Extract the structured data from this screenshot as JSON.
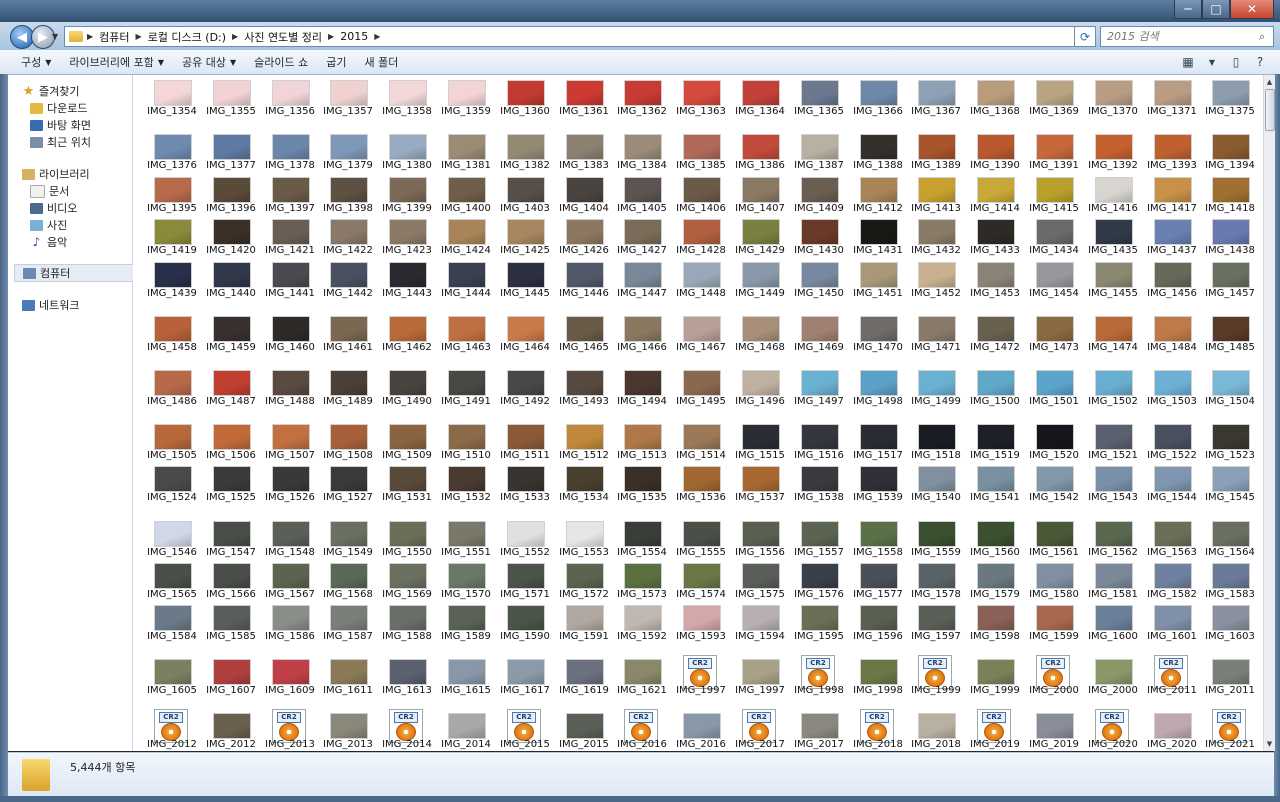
{
  "window": {
    "controls": [
      "minimize-icon",
      "maximize-icon",
      "close-icon"
    ],
    "control_glyphs": [
      "─",
      "□",
      "✕"
    ]
  },
  "address": {
    "crumbs": [
      "컴퓨터",
      "로컬 디스크 (D:)",
      "사진 연도별 정리",
      "2015"
    ],
    "search_placeholder": "2015 검색"
  },
  "toolbar": {
    "items": [
      {
        "label": "구성",
        "dropdown": true
      },
      {
        "label": "라이브러리에 포함",
        "dropdown": true
      },
      {
        "label": "공유 대상",
        "dropdown": true
      },
      {
        "label": "슬라이드 쇼",
        "dropdown": false
      },
      {
        "label": "굽기",
        "dropdown": false
      },
      {
        "label": "새 폴더",
        "dropdown": false
      }
    ]
  },
  "nav": {
    "items": [
      {
        "label": "즐겨찾기",
        "icon": "star-icon",
        "level": 0
      },
      {
        "label": "다운로드",
        "icon": "download-folder-icon",
        "level": 1
      },
      {
        "label": "바탕 화면",
        "icon": "desktop-icon",
        "level": 1
      },
      {
        "label": "최근 위치",
        "icon": "recent-places-icon",
        "level": 1
      },
      {
        "label": "라이브러리",
        "icon": "library-icon",
        "level": 0
      },
      {
        "label": "문서",
        "icon": "document-icon",
        "level": 1
      },
      {
        "label": "비디오",
        "icon": "video-icon",
        "level": 1
      },
      {
        "label": "사진",
        "icon": "picture-icon",
        "level": 1
      },
      {
        "label": "음악",
        "icon": "music-icon",
        "level": 1
      },
      {
        "label": "컴퓨터",
        "icon": "computer-icon",
        "level": 0,
        "selected": true
      },
      {
        "label": "네트워크",
        "icon": "network-icon",
        "level": 0
      }
    ]
  },
  "files": [
    [
      "IMG_1354",
      "IMG_1355",
      "IMG_1356",
      "IMG_1357",
      "IMG_1358",
      "IMG_1359",
      "IMG_1360",
      "IMG_1361",
      "IMG_1362",
      "IMG_1363",
      "IMG_1364",
      "IMG_1365",
      "IMG_1366",
      "IMG_1367",
      "IMG_1368",
      "IMG_1369",
      "IMG_1370",
      "IMG_1371",
      "IMG_1375"
    ],
    [
      "IMG_1376",
      "IMG_1377",
      "IMG_1378",
      "IMG_1379",
      "IMG_1380",
      "IMG_1381",
      "IMG_1382",
      "IMG_1383",
      "IMG_1384",
      "IMG_1385",
      "IMG_1386",
      "IMG_1387",
      "IMG_1388",
      "IMG_1389",
      "IMG_1390",
      "IMG_1391",
      "IMG_1392",
      "IMG_1393",
      "IMG_1394"
    ],
    [
      "IMG_1395",
      "IMG_1396",
      "IMG_1397",
      "IMG_1398",
      "IMG_1399",
      "IMG_1400",
      "IMG_1403",
      "IMG_1404",
      "IMG_1405",
      "IMG_1406",
      "IMG_1407",
      "IMG_1409",
      "IMG_1412",
      "IMG_1413",
      "IMG_1414",
      "IMG_1415",
      "IMG_1416",
      "IMG_1417",
      "IMG_1418"
    ],
    [
      "IMG_1419",
      "IMG_1420",
      "IMG_1421",
      "IMG_1422",
      "IMG_1423",
      "IMG_1424",
      "IMG_1425",
      "IMG_1426",
      "IMG_1427",
      "IMG_1428",
      "IMG_1429",
      "IMG_1430",
      "IMG_1431",
      "IMG_1432",
      "IMG_1433",
      "IMG_1434",
      "IMG_1435",
      "IMG_1437",
      "IMG_1438"
    ],
    [
      "IMG_1439",
      "IMG_1440",
      "IMG_1441",
      "IMG_1442",
      "IMG_1443",
      "IMG_1444",
      "IMG_1445",
      "IMG_1446",
      "IMG_1447",
      "IMG_1448",
      "IMG_1449",
      "IMG_1450",
      "IMG_1451",
      "IMG_1452",
      "IMG_1453",
      "IMG_1454",
      "IMG_1455",
      "IMG_1456",
      "IMG_1457"
    ],
    [
      "IMG_1458",
      "IMG_1459",
      "IMG_1460",
      "IMG_1461",
      "IMG_1462",
      "IMG_1463",
      "IMG_1464",
      "IMG_1465",
      "IMG_1466",
      "IMG_1467",
      "IMG_1468",
      "IMG_1469",
      "IMG_1470",
      "IMG_1471",
      "IMG_1472",
      "IMG_1473",
      "IMG_1474",
      "IMG_1484",
      "IMG_1485"
    ],
    [
      "IMG_1486",
      "IMG_1487",
      "IMG_1488",
      "IMG_1489",
      "IMG_1490",
      "IMG_1491",
      "IMG_1492",
      "IMG_1493",
      "IMG_1494",
      "IMG_1495",
      "IMG_1496",
      "IMG_1497",
      "IMG_1498",
      "IMG_1499",
      "IMG_1500",
      "IMG_1501",
      "IMG_1502",
      "IMG_1503",
      "IMG_1504"
    ],
    [
      "IMG_1505",
      "IMG_1506",
      "IMG_1507",
      "IMG_1508",
      "IMG_1509",
      "IMG_1510",
      "IMG_1511",
      "IMG_1512",
      "IMG_1513",
      "IMG_1514",
      "IMG_1515",
      "IMG_1516",
      "IMG_1517",
      "IMG_1518",
      "IMG_1519",
      "IMG_1520",
      "IMG_1521",
      "IMG_1522",
      "IMG_1523"
    ],
    [
      "IMG_1524",
      "IMG_1525",
      "IMG_1526",
      "IMG_1527",
      "IMG_1531",
      "IMG_1532",
      "IMG_1533",
      "IMG_1534",
      "IMG_1535",
      "IMG_1536",
      "IMG_1537",
      "IMG_1538",
      "IMG_1539",
      "IMG_1540",
      "IMG_1541",
      "IMG_1542",
      "IMG_1543",
      "IMG_1544",
      "IMG_1545"
    ],
    [
      "IMG_1546",
      "IMG_1547",
      "IMG_1548",
      "IMG_1549",
      "IMG_1550",
      "IMG_1551",
      "IMG_1552",
      "IMG_1553",
      "IMG_1554",
      "IMG_1555",
      "IMG_1556",
      "IMG_1557",
      "IMG_1558",
      "IMG_1559",
      "IMG_1560",
      "IMG_1561",
      "IMG_1562",
      "IMG_1563",
      "IMG_1564"
    ],
    [
      "IMG_1565",
      "IMG_1566",
      "IMG_1567",
      "IMG_1568",
      "IMG_1569",
      "IMG_1570",
      "IMG_1571",
      "IMG_1572",
      "IMG_1573",
      "IMG_1574",
      "IMG_1575",
      "IMG_1576",
      "IMG_1577",
      "IMG_1578",
      "IMG_1579",
      "IMG_1580",
      "IMG_1581",
      "IMG_1582",
      "IMG_1583"
    ],
    [
      "IMG_1584",
      "IMG_1585",
      "IMG_1586",
      "IMG_1587",
      "IMG_1588",
      "IMG_1589",
      "IMG_1590",
      "IMG_1591",
      "IMG_1592",
      "IMG_1593",
      "IMG_1594",
      "IMG_1595",
      "IMG_1596",
      "IMG_1597",
      "IMG_1598",
      "IMG_1599",
      "IMG_1600",
      "IMG_1601",
      "IMG_1603"
    ],
    [
      "IMG_1605",
      "IMG_1607",
      "IMG_1609",
      "IMG_1611",
      "IMG_1613",
      "IMG_1615",
      "IMG_1617",
      "IMG_1619",
      "IMG_1621",
      "IMG_1997",
      "IMG_1997",
      "IMG_1998",
      "IMG_1998",
      "IMG_1999",
      "IMG_1999",
      "IMG_2000",
      "IMG_2000",
      "IMG_2011",
      "IMG_2011"
    ],
    [
      "IMG_2012",
      "IMG_2012",
      "IMG_2013",
      "IMG_2013",
      "IMG_2014",
      "IMG_2014",
      "IMG_2015",
      "IMG_2015",
      "IMG_2016",
      "IMG_2016",
      "IMG_2017",
      "IMG_2017",
      "IMG_2018",
      "IMG_2018",
      "IMG_2019",
      "IMG_2019",
      "IMG_2020",
      "IMG_2020",
      "IMG_2021"
    ]
  ],
  "cr2_cells": [
    [
      12,
      9
    ],
    [
      12,
      11
    ],
    [
      12,
      13
    ],
    [
      12,
      15
    ],
    [
      12,
      17
    ],
    [
      13,
      0
    ],
    [
      13,
      2
    ],
    [
      13,
      4
    ],
    [
      13,
      6
    ],
    [
      13,
      8
    ],
    [
      13,
      10
    ],
    [
      13,
      12
    ],
    [
      13,
      14
    ],
    [
      13,
      16
    ],
    [
      13,
      18
    ]
  ],
  "cr2_label": "CR2",
  "row_colors": [
    [
      "#f4d6d6",
      "#f2d2d4",
      "#f0d4d8",
      "#efd2d0",
      "#f3d8da",
      "#f2d4d6",
      "#c23a30",
      "#cc3a32",
      "#c83a34",
      "#d44a3e",
      "#c2403a",
      "#6b7890",
      "#6f88a8",
      "#8ea0b5",
      "#b89c7c",
      "#b8a483",
      "#b99d83",
      "#b99c82",
      "#8c9db0"
    ],
    [
      "#6e8ab0",
      "#5e7aa2",
      "#6a86aa",
      "#7e98b8",
      "#98abc2",
      "#9a8c74",
      "#948a74",
      "#8c8070",
      "#9a8c78",
      "#b06a5a",
      "#c24a3a",
      "#b8b0a0",
      "#34302c",
      "#a8542c",
      "#b8582e",
      "#c6683a",
      "#c4602e",
      "#c0602e",
      "#8a5a30"
    ],
    [
      "#b86a4a",
      "#5a4a3a",
      "#6a5a48",
      "#5e5042",
      "#7a6a56",
      "#6e5e4a",
      "#585048",
      "#4a4440",
      "#5c5450",
      "#6a5a48",
      "#8a7a64",
      "#6a5e50",
      "#a88458",
      "#c8a030",
      "#c8a838",
      "#b8a02c",
      "#d8d4d0",
      "#c89048",
      "#a07030"
    ],
    [
      "#8a8a3a",
      "#3a3028",
      "#6a5e54",
      "#8a7868",
      "#8c7a68",
      "#a88458",
      "#a88660",
      "#8c7860",
      "#7a6c58",
      "#b06040",
      "#7a8040",
      "#6a3a28",
      "#1a1814",
      "#8a7a68",
      "#2e2a26",
      "#6a6a6a",
      "#303a48",
      "#6a80b0",
      "#6a7ab0"
    ],
    [
      "#28304a",
      "#30384a",
      "#4a4a50",
      "#4a5060",
      "#2a2a30",
      "#3a4050",
      "#2c3040",
      "#50586a",
      "#788898",
      "#98a8b8",
      "#8898a8",
      "#7888a0",
      "#a89878",
      "#c8b090",
      "#8a8478",
      "#98989c",
      "#8a8870",
      "#686858",
      "#6a7060"
    ],
    [
      "#b8603a",
      "#3a3030",
      "#2e2a28",
      "#7a6850",
      "#b86a38",
      "#c07040",
      "#c87a48",
      "#6a5a48",
      "#8a7860",
      "#b8a098",
      "#a89078",
      "#a08070",
      "#706a68",
      "#8a7a6a",
      "#6a6050",
      "#8a6a40",
      "#b86a38",
      "#c07a48",
      "#5a3a28"
    ],
    [
      "#b86a48",
      "#c04030",
      "#5a4a40",
      "#4a4038",
      "#4a4440",
      "#4a4844",
      "#4a4846",
      "#584a40",
      "#4a3830",
      "#8a6850",
      "#c0b0a0",
      "#6ab0d0",
      "#5aa0c8",
      "#6ab0d0",
      "#60a8c8",
      "#5aa4cc",
      "#68aed0",
      "#6cb0d4",
      "#7ab8d8"
    ],
    [
      "#b8683a",
      "#c06a3a",
      "#c27040",
      "#a8603a",
      "#8a6440",
      "#8a6a48",
      "#8a5a38",
      "#c0883a",
      "#b07848",
      "#9a7858",
      "#2a2e34",
      "#34383e",
      "#2a2c34",
      "#1a1c24",
      "#1e2028",
      "#14161c",
      "#5a6070",
      "#4a5060",
      "#3a3830"
    ],
    [
      "#4a4a4a",
      "#3a3a3a",
      "#3a3838",
      "#3a3a3a",
      "#5a4a3a",
      "#4a3a30",
      "#3a3430",
      "#4a4030",
      "#3a3028",
      "#a06830",
      "#a86830",
      "#3a3a40",
      "#303038",
      "#8090a0",
      "#7890a0",
      "#8098a8",
      "#7890a8",
      "#7e96b0",
      "#8aa0b8"
    ],
    [
      "#d0d8e8",
      "#4a4e48",
      "#5a6058",
      "#6a7060",
      "#6a7058",
      "#7a7868",
      "#e0e0e0",
      "#e6e6e6",
      "#3a3e38",
      "#4a5048",
      "#5a6050",
      "#5a6450",
      "#5a7048",
      "#3a5030",
      "#3a5030",
      "#4a5838",
      "#5a6850",
      "#6a7058",
      "#6a7060"
    ],
    [
      "#4a5048",
      "#4a4e48",
      "#5a6450",
      "#5a6858",
      "#6a7060",
      "#6a7868",
      "#4a5448",
      "#5a6450",
      "#5a7040",
      "#6a7848",
      "#5a5e58",
      "#3a4048",
      "#4a5058",
      "#5a6468",
      "#6a7880",
      "#8090a0",
      "#7a8898",
      "#7080a0",
      "#6a7a98"
    ],
    [
      "#6a7a88",
      "#5a5e5a",
      "#8a8e88",
      "#7a7e78",
      "#6a6e68",
      "#5a6258",
      "#4a5448",
      "#b0a8a0",
      "#c0b8b0",
      "#d4a8a8",
      "#b8b0b0",
      "#6a7058",
      "#5a6050",
      "#5a6058",
      "#8a6058",
      "#a86850",
      "#6a8098",
      "#8090a8",
      "#8a90a0"
    ],
    [
      "#7a8060",
      "#b04040",
      "#c04048",
      "#8a7a58",
      "#5a6070",
      "#8898a8",
      "#8a9aa8",
      "#6a7080",
      "#8a8868",
      "#ffffff",
      "#a8a088",
      "#ffffff",
      "#6a7848",
      "#ffffff",
      "#7a8058",
      "#ffffff",
      "#8a9868",
      "#ffffff",
      "#7a8078"
    ],
    [
      "#ffffff",
      "#6a6050",
      "#ffffff",
      "#8a8878",
      "#ffffff",
      "#a8a8a8",
      "#ffffff",
      "#5a6058",
      "#ffffff",
      "#8898a8",
      "#ffffff",
      "#8a8880",
      "#ffffff",
      "#b8b0a0",
      "#ffffff",
      "#8a8e98",
      "#ffffff",
      "#c0a8b0",
      "#ffffff"
    ]
  ],
  "status": {
    "count_text": "5,444개 항목"
  }
}
